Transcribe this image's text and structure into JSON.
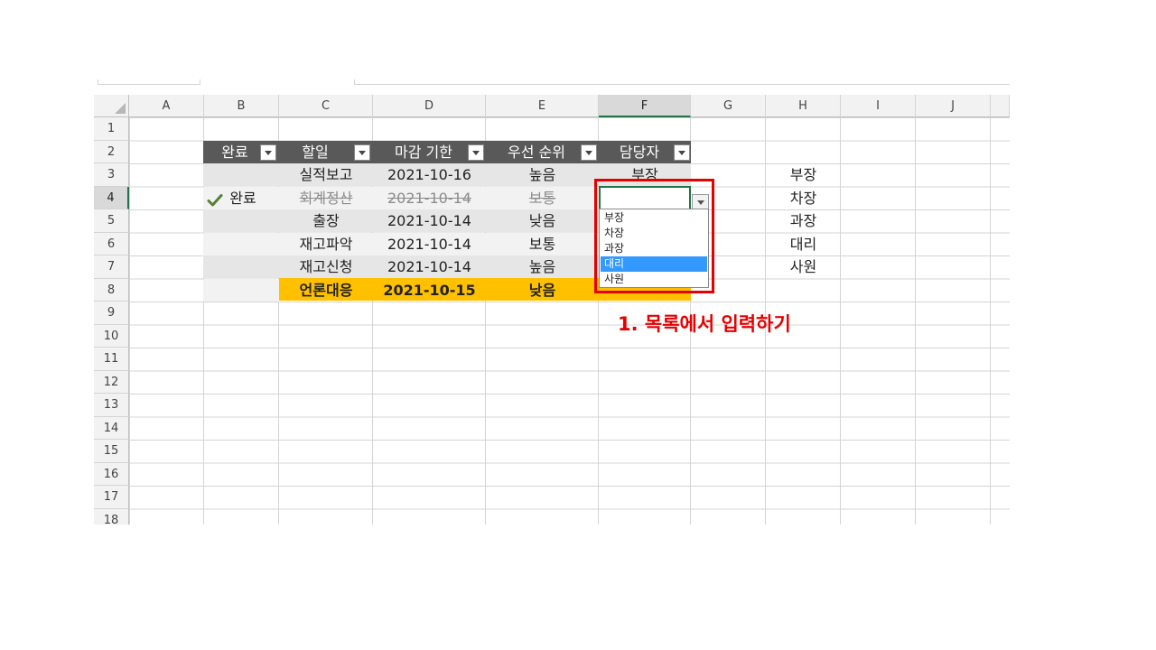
{
  "columns": [
    "A",
    "B",
    "C",
    "D",
    "E",
    "F",
    "G",
    "H",
    "I",
    "J"
  ],
  "rows": [
    "1",
    "2",
    "3",
    "4",
    "5",
    "6",
    "7",
    "8",
    "9",
    "10",
    "11",
    "12",
    "13",
    "14",
    "15",
    "16",
    "17",
    "18"
  ],
  "table_header": {
    "done": "완료",
    "task": "할일",
    "deadline": "마감 기한",
    "priority": "우선 순위",
    "owner": "담당자"
  },
  "table_rows": [
    {
      "done": "",
      "task": "실적보고",
      "deadline": "2021-10-16",
      "priority": "높음",
      "owner": "부장"
    },
    {
      "done": "완료",
      "task": "회계정산",
      "deadline": "2021-10-14",
      "priority": "보통",
      "owner": ""
    },
    {
      "done": "",
      "task": "출장",
      "deadline": "2021-10-14",
      "priority": "낮음",
      "owner": ""
    },
    {
      "done": "",
      "task": "재고파악",
      "deadline": "2021-10-14",
      "priority": "보통",
      "owner": ""
    },
    {
      "done": "",
      "task": "재고신청",
      "deadline": "2021-10-14",
      "priority": "높음",
      "owner": ""
    },
    {
      "done": "",
      "task": "언론대응",
      "deadline": "2021-10-15",
      "priority": "낮음",
      "owner": ""
    }
  ],
  "side_list": [
    "부장",
    "차장",
    "과장",
    "대리",
    "사원"
  ],
  "dropdown": {
    "options": [
      "부장",
      "차장",
      "과장",
      "대리",
      "사원"
    ],
    "highlighted": "대리"
  },
  "annotation": "1. 목록에서 입력하기",
  "colors": {
    "header_bg": "#595959",
    "highlight_row": "#ffc000",
    "annotation_red": "#e60000",
    "selection_green": "#217346",
    "list_highlight": "#3399ff"
  }
}
